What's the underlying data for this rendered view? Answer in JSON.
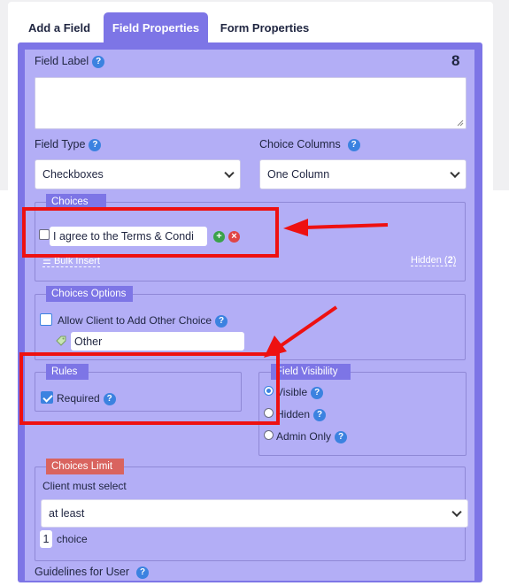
{
  "tabs": [
    {
      "label": "Add a Field",
      "active": false
    },
    {
      "label": "Field Properties",
      "active": true
    },
    {
      "label": "Form Properties",
      "active": false
    }
  ],
  "field_number": "8",
  "field_label": {
    "label": "Field Label",
    "value": ""
  },
  "field_type": {
    "label": "Field Type",
    "selected": "Checkboxes"
  },
  "choice_columns": {
    "label": "Choice Columns",
    "selected": "One Column"
  },
  "choices": {
    "legend": "Choices",
    "items": [
      {
        "value": "I agree to the Terms & Condi",
        "checked": false
      }
    ],
    "bulk_insert": "Bulk Insert",
    "hidden_label": "Hidden (",
    "hidden_count": "2",
    "hidden_close": ")"
  },
  "choices_options": {
    "legend": "Choices Options",
    "allow_other_label": "Allow Client to Add Other Choice",
    "other_value": "Other"
  },
  "rules": {
    "legend": "Rules",
    "required_label": "Required",
    "required_checked": true
  },
  "field_visibility": {
    "legend": "Field Visibility",
    "options": [
      {
        "label": "Visible",
        "selected": true
      },
      {
        "label": "Hidden",
        "selected": false
      },
      {
        "label": "Admin Only",
        "selected": false
      }
    ]
  },
  "choices_limit": {
    "legend": "Choices Limit",
    "client_label": "Client must select",
    "mode": "at least",
    "count": "1",
    "unit": "choice"
  },
  "guidelines_label": "Guidelines for User",
  "colors": {
    "accent": "#7d75e6",
    "panel_bg": "#b3aef6",
    "help_icon": "#3b82e0",
    "limit_legend": "#d9645f",
    "annotation": "#ee1111"
  },
  "icons": [
    "help-icon",
    "add-icon",
    "remove-icon",
    "chevron-down-icon",
    "tag-icon",
    "list-icon",
    "arrow-icon"
  ]
}
